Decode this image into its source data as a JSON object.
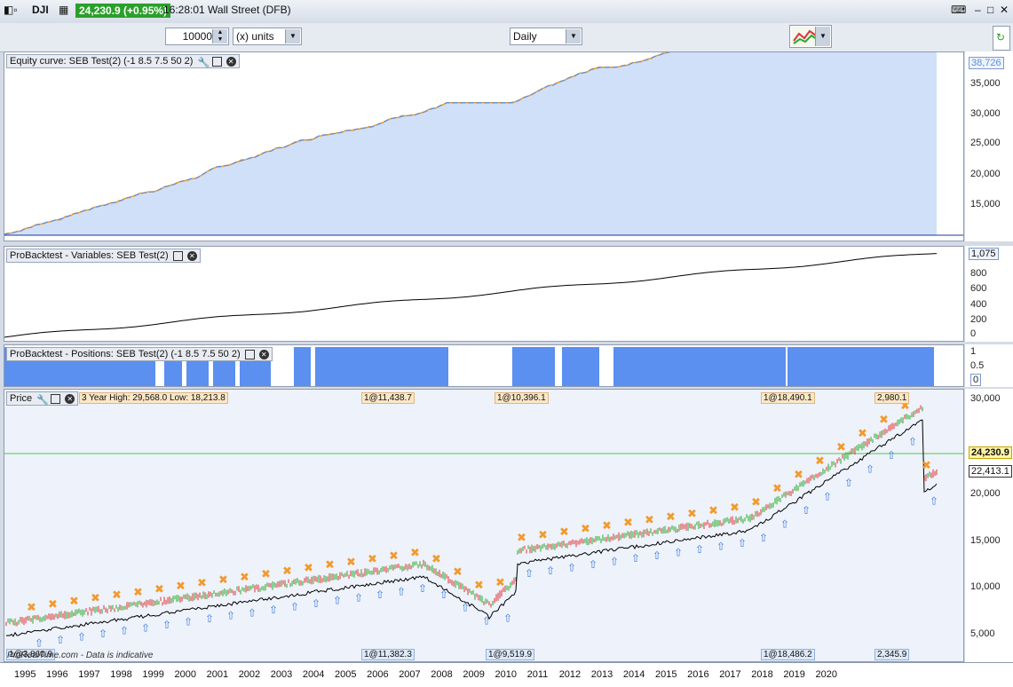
{
  "titlebar": {
    "symbol": "DJI",
    "price": "24,230.9 (+0.95%)",
    "time_market": "16:28:01 Wall Street (DFB)"
  },
  "toolbar": {
    "size_value": "10000",
    "units_label": "(x) units",
    "timeframe": "Daily"
  },
  "equity_panel": {
    "title": "Equity curve: SEB Test(2) (-1 8.5 7.5 50 2)",
    "ticks": [
      "35,000",
      "30,000",
      "25,000",
      "20,000",
      "15,000"
    ],
    "last_value": "38,726"
  },
  "variables_panel": {
    "title": "ProBacktest - Variables: SEB Test(2)",
    "ticks": [
      "1,075",
      "800",
      "600",
      "400",
      "200",
      "0"
    ]
  },
  "positions_panel": {
    "title": "ProBacktest - Positions: SEB Test(2) (-1 8.5 7.5 50 2)",
    "ticks": [
      "1",
      "0.5",
      "0"
    ]
  },
  "price_panel": {
    "title": "Price",
    "ticks": [
      "30,000",
      "25,000",
      "20,000",
      "15,000",
      "10,000",
      "5,000"
    ],
    "last_price": "24,230.9",
    "level_price": "22,413.1",
    "top_labels": [
      "3 Year High: 29,568.0 Low: 18,213.8",
      "1@11,438.7",
      "1@10,396.1",
      "1@18,490.1",
      "2,980.1"
    ],
    "bottom_labels": [
      "1@3,860.9",
      "1@11,382.3",
      "1@9,519.9",
      "1@18,486.2",
      "2,345.9"
    ],
    "watermark": "ProRealTime.com - Data is indicative"
  },
  "x_axis": {
    "years": [
      "1995",
      "1996",
      "1997",
      "1998",
      "1999",
      "2000",
      "2001",
      "2002",
      "2003",
      "2004",
      "2005",
      "2006",
      "2007",
      "2008",
      "2009",
      "2010",
      "2011",
      "2012",
      "2013",
      "2014",
      "2015",
      "2016",
      "2017",
      "2018",
      "2019",
      "2020"
    ]
  },
  "colors": {
    "equity_line": "#5b8fe0",
    "equity_flat": "#f39a2b",
    "equity_fill": "#cfe0f8",
    "position_fill": "#5b8ff0",
    "price_up": "#27a827",
    "price_down": "#d33",
    "price_badge": "#2aa02a"
  }
}
